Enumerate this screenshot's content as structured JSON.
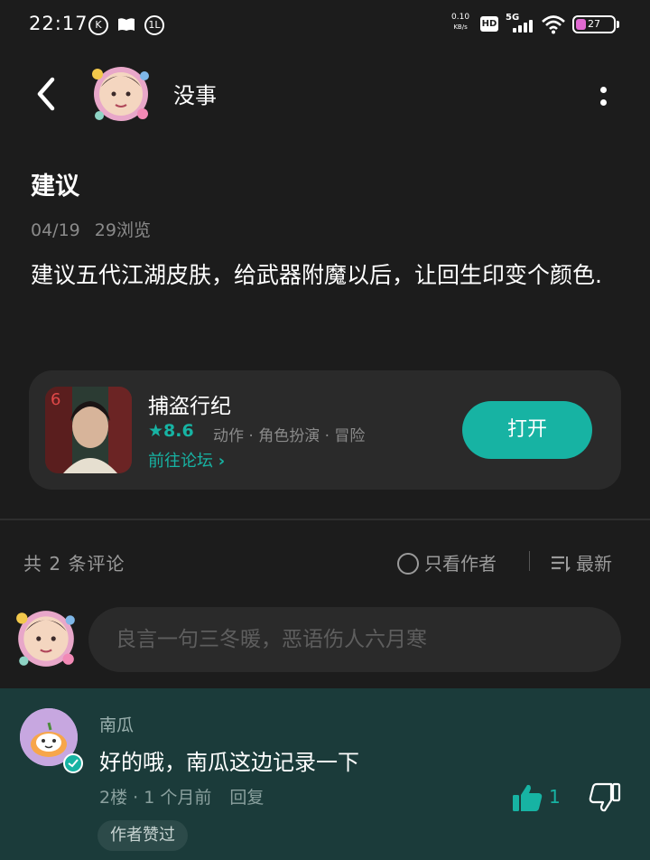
{
  "status_bar": {
    "time": "22:17",
    "icons": [
      "k-circle-icon",
      "book-icon",
      "badge-icon"
    ],
    "net_speed_value": "0.10",
    "net_speed_unit": "KB/s",
    "hd_label": "HD",
    "network_label": "5G",
    "battery_level": "27"
  },
  "header": {
    "name": "没事"
  },
  "post": {
    "title": "建议",
    "date": "04/19",
    "views": "29浏览",
    "body": "建议五代江湖皮肤，给武器附魔以后，让回生印变个颜色."
  },
  "game_card": {
    "name": "捕盗行纪",
    "rating": "8.6",
    "tags": "动作 · 角色扮演 · 冒险",
    "forum_link": "前往论坛",
    "open_button": "打开",
    "accent_color": "#17b3a3"
  },
  "comments_header": {
    "count_text": "共 2 条评论",
    "author_only": "只看作者",
    "sort_label": "最新"
  },
  "comment_input": {
    "placeholder": "良言一句三冬暖，恶语伤人六月寒"
  },
  "comments": [
    {
      "author": "南瓜",
      "text": "好的哦，南瓜这边记录一下",
      "floor": "2楼",
      "time": "1 个月前",
      "reply_label": "回复",
      "likes": "1",
      "badge": "作者赞过"
    }
  ]
}
